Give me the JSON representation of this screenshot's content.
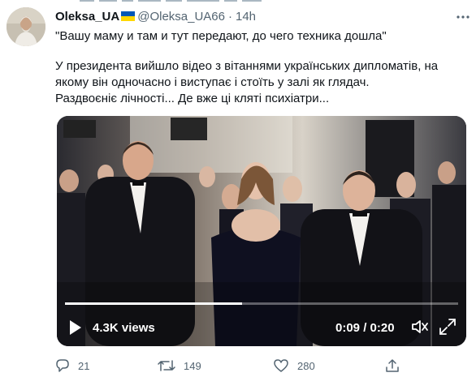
{
  "tweet": {
    "author_name": "Oleksa_UA",
    "author_handle": "@Oleksa_UA66",
    "separator": "·",
    "time": "14h",
    "lines": [
      "\"Вашу маму и там и тут передают, до чего техника дошла\"",
      "",
      "У президента вийшло відео з вітаннями українських дипломатів, на",
      "якому він одночасно і виступає і стоїть у залі як глядач.",
      "Раздвоєніє лічності... Де вже ці кляті психіатри..."
    ]
  },
  "video": {
    "views": "4.3K views",
    "time_display": "0:09 / 0:20",
    "progress": 0.45
  },
  "actions": {
    "reply_count": "21",
    "retweet_count": "149",
    "like_count": "280"
  },
  "icons": [
    "more-icon",
    "play-icon",
    "volume-icon",
    "fullscreen-icon",
    "reply-icon",
    "retweet-icon",
    "like-icon",
    "share-icon"
  ],
  "colors": {
    "text": "#0f1419",
    "secondary": "#536471",
    "flag_blue": "#0057b7",
    "flag_yellow": "#ffd700"
  }
}
